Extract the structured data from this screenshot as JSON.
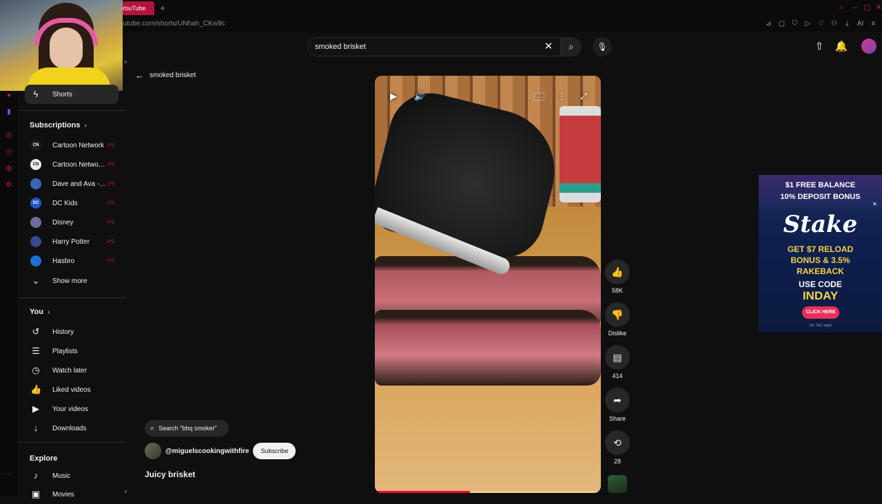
{
  "browser": {
    "tab_label": "YouTube",
    "url": "youtube.com/shorts/UNhah_CKw9c",
    "window_controls": [
      "search-icon",
      "minimize-icon",
      "maximize-icon",
      "close-icon"
    ],
    "ext_icons": [
      "bookmark-icon",
      "square-icon",
      "shield-icon",
      "play-icon",
      "heart-icon",
      "profile-icon",
      "download-icon",
      "ai-icon",
      "menu-icon"
    ],
    "ai_label": "AI"
  },
  "search": {
    "query": "smoked brisket"
  },
  "sidebar": {
    "shorts_label": "Shorts",
    "subscriptions_heading": "Subscriptions",
    "subscriptions": [
      {
        "label": "Cartoon Network",
        "avatar_text": "CN",
        "avatar_color": "#1c1c1c",
        "live": true
      },
      {
        "label": "Cartoon Network...",
        "avatar_text": "CN",
        "avatar_color": "#eaeaea",
        "live": true
      },
      {
        "label": "Dave and Ava - N...",
        "avatar_text": "",
        "avatar_color": "#3a63b8",
        "live": true
      },
      {
        "label": "DC Kids",
        "avatar_text": "DC",
        "avatar_color": "#1f58c9",
        "live": true
      },
      {
        "label": "Disney",
        "avatar_text": "",
        "avatar_color": "#6d6f9a",
        "live": true
      },
      {
        "label": "Harry Potter",
        "avatar_text": "",
        "avatar_color": "#3b4a8a",
        "live": true
      },
      {
        "label": "Hasbro",
        "avatar_text": "",
        "avatar_color": "#1e6fd1",
        "live": true
      }
    ],
    "show_more_label": "Show more",
    "you_heading": "You",
    "you_items": [
      {
        "label": "History",
        "icon": "history-icon",
        "glyph": "↺"
      },
      {
        "label": "Playlists",
        "icon": "playlists-icon",
        "glyph": "☰"
      },
      {
        "label": "Watch later",
        "icon": "clock-icon",
        "glyph": "◷"
      },
      {
        "label": "Liked videos",
        "icon": "thumbs-up-icon",
        "glyph": "👍"
      },
      {
        "label": "Your videos",
        "icon": "video-icon",
        "glyph": "▶"
      },
      {
        "label": "Downloads",
        "icon": "download-icon",
        "glyph": "↓"
      }
    ],
    "explore_heading": "Explore",
    "explore_items": [
      {
        "label": "Music",
        "icon": "music-icon",
        "glyph": "♪"
      },
      {
        "label": "Movies",
        "icon": "movies-icon",
        "glyph": "▣"
      }
    ]
  },
  "back": {
    "label": "smoked brisket"
  },
  "video": {
    "progress": 0.42
  },
  "actions": {
    "likes": "58K",
    "dislike_label": "Dislike",
    "comments": "414",
    "share_label": "Share",
    "remix": "28"
  },
  "info": {
    "related_search": "Search \"bbq smoker\"",
    "channel": "@miguelscookingwithfire",
    "subscribe_label": "Subscribe",
    "title": "Juicy brisket"
  },
  "ad": {
    "line1": "$1 FREE BALANCE",
    "line2": "10% DEPOSIT BONUS",
    "brand": "Stake",
    "line3a": "GET $7 RELOAD",
    "line3b": "BONUS & 3.5%",
    "line3c": "RAKEBACK",
    "line4": "USE CODE",
    "code": "INDAY",
    "cta": "CLICK HERE",
    "fine": "18+ T&C apply",
    "close": "✕"
  },
  "colors": {
    "background": "#0f0f0f",
    "accent_red": "#ff0033",
    "tab_active": "#b3123b"
  }
}
